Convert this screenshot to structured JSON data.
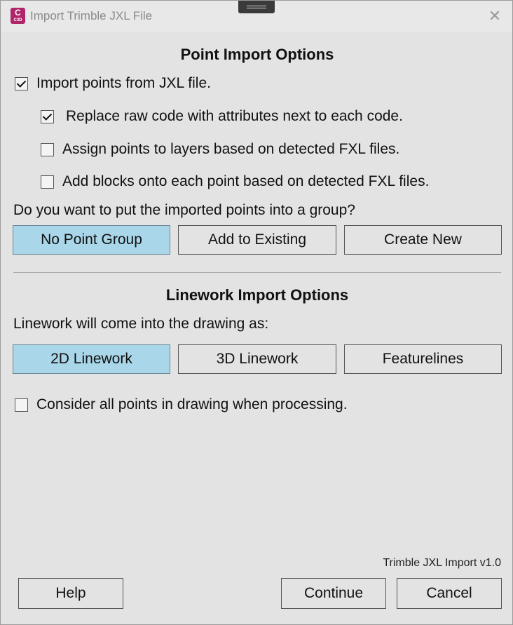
{
  "titlebar": {
    "title": "Import Trimble JXL File",
    "icon_letter": "C",
    "icon_sub": "C3D"
  },
  "point_section": {
    "title": "Point Import Options",
    "import_points": {
      "label": "Import points from JXL file.",
      "checked": true
    },
    "replace_code": {
      "label": "Replace raw code with attributes next to each code.",
      "checked": true
    },
    "assign_layers": {
      "label": "Assign points to layers based on detected FXL files.",
      "checked": false
    },
    "add_blocks": {
      "label": "Add blocks onto each point based on detected FXL files.",
      "checked": false
    },
    "group_question": "Do you want to put the imported points into a group?",
    "group_buttons": [
      {
        "label": "No Point Group",
        "selected": true
      },
      {
        "label": "Add to Existing",
        "selected": false
      },
      {
        "label": "Create New",
        "selected": false
      }
    ]
  },
  "linework_section": {
    "title": "Linework Import Options",
    "question": "Linework will come into the drawing as:",
    "buttons": [
      {
        "label": "2D Linework",
        "selected": true
      },
      {
        "label": "3D Linework",
        "selected": false
      },
      {
        "label": "Featurelines",
        "selected": false
      }
    ],
    "consider_all": {
      "label": "Consider all points in drawing when processing.",
      "checked": false
    }
  },
  "footer": {
    "version": "Trimble JXL Import v1.0",
    "help_label": "Help",
    "continue_label": "Continue",
    "cancel_label": "Cancel"
  },
  "colors": {
    "selected_button": "#a9d6e8",
    "app_icon": "#b0246a"
  }
}
